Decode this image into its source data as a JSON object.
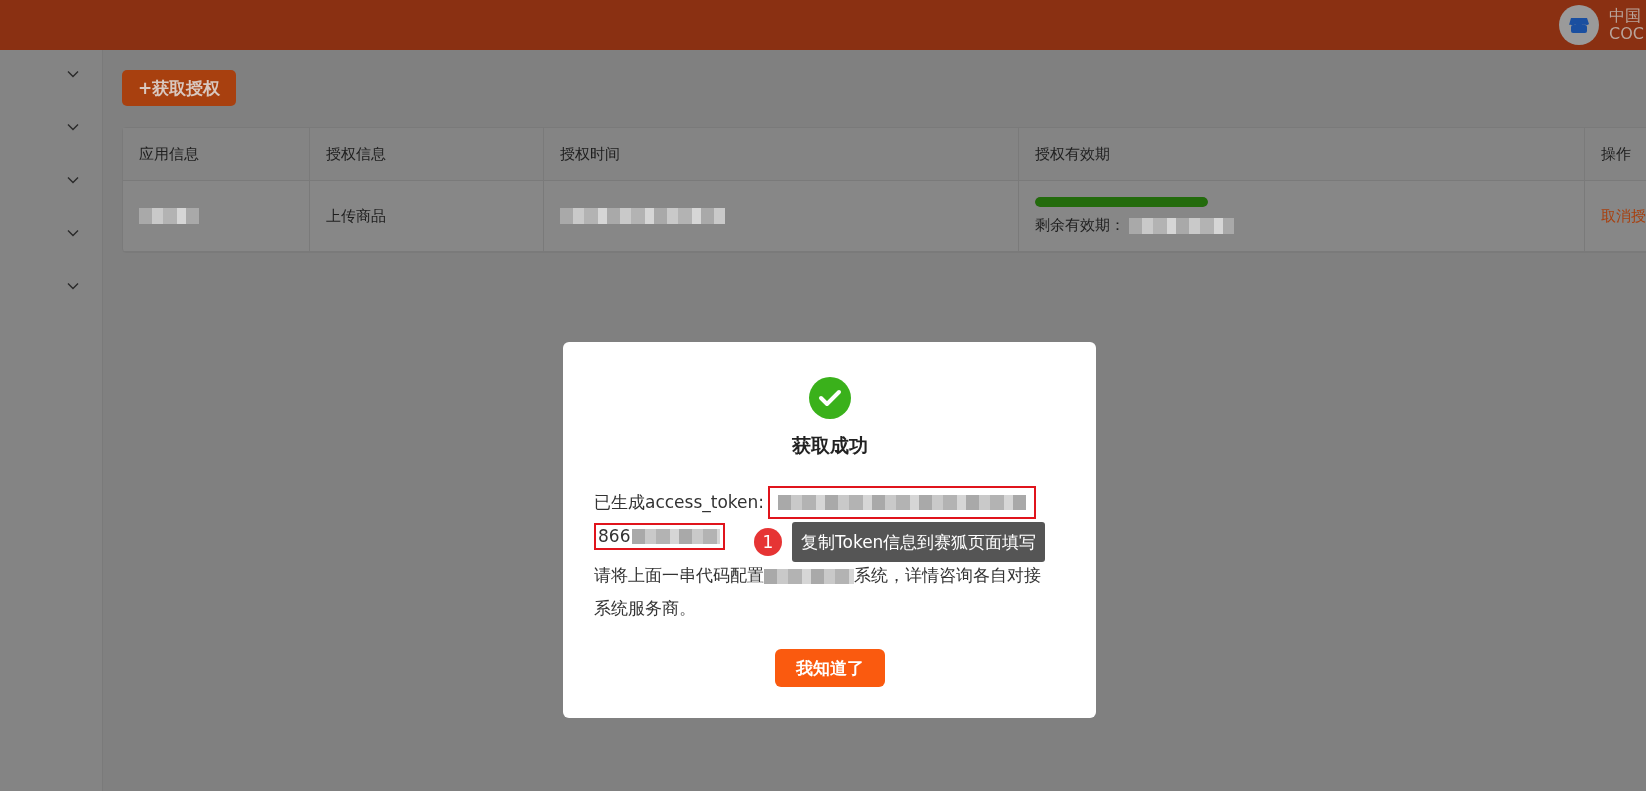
{
  "header": {
    "user_name": "中国",
    "user_sub": "COC"
  },
  "sidebar": {
    "items": [
      {
        "expanded": false
      },
      {
        "expanded": false
      },
      {
        "expanded": false
      },
      {
        "expanded": false
      },
      {
        "expanded": false
      }
    ]
  },
  "toolbar": {
    "add_button": "+获取授权"
  },
  "table": {
    "columns": [
      "应用信息",
      "授权信息",
      "授权时间",
      "授权有效期",
      "操作"
    ],
    "rows": [
      {
        "cells": [
          {
            "kind": "redacted"
          },
          {
            "kind": "text",
            "text": "上传商品"
          },
          {
            "kind": "redacted"
          },
          {
            "kind": "validity",
            "level": 1,
            "label": "剩余有效期："
          },
          {
            "kind": "link",
            "text": "取消授"
          }
        ]
      }
    ]
  },
  "dialog": {
    "title": "获取成功",
    "token_label": "已生成access_token:",
    "token_prefix": "866",
    "message_before": "请将上面一串代码配置",
    "message_after": "系统，详情咨询各自对接系统服务商。",
    "button": "我知道了",
    "annotation": {
      "number": "1",
      "text": "复制Token信息到赛狐页面填写"
    }
  }
}
